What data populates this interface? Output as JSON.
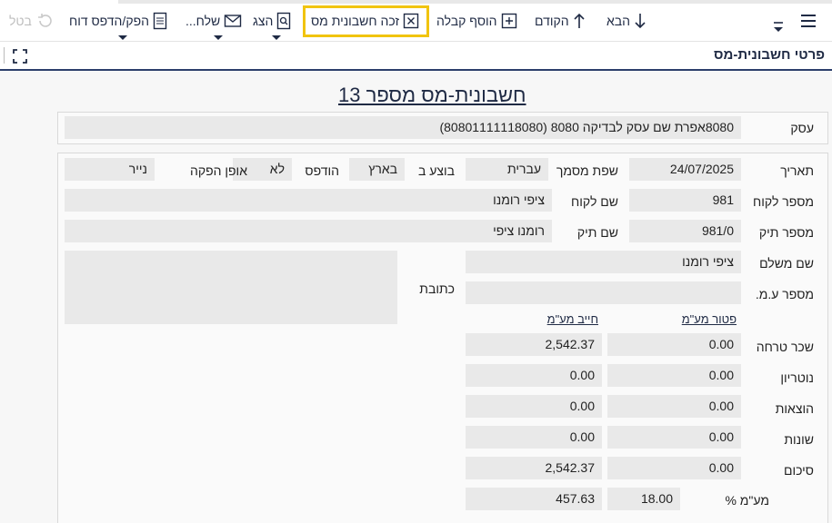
{
  "toolbar": {
    "cancel_label": "בטל",
    "print_label": "הפק/הדפס דוח",
    "send_label": "שלח...",
    "show_label": "הצג",
    "credit_label": "זכה חשבונית מס",
    "add_receipt_label": "הוסף קבלה",
    "previous_label": "הקודם",
    "next_label": "הבא"
  },
  "section": {
    "title": "פרטי חשבונית-מס"
  },
  "document": {
    "title": "חשבונית-מס מספר 13"
  },
  "business": {
    "label": "עסק",
    "value": "8080אפרת שם עסק לבדיקה 8080 (80801111118080)"
  },
  "fields": {
    "date_label": "תאריך",
    "date_value": "24/07/2025",
    "doc_lang_label": "שפת מסמך",
    "doc_lang_value": "עברית",
    "performed_in_label": "בוצע ב",
    "performed_in_value": "בארץ",
    "printed_label": "הודפס",
    "printed_value": "לא",
    "issue_method_label": "אופן הפקה",
    "issue_method_value": "נייר",
    "customer_no_label": "מספר לקוח",
    "customer_no_value": "981",
    "customer_name_label": "שם לקוח",
    "customer_name_value": "ציפי רומנו",
    "file_no_label": "מספר תיק",
    "file_no_value": "981/0",
    "file_name_label": "שם תיק",
    "file_name_value": "רומנו ציפי",
    "payer_name_label": "שם משלם",
    "payer_name_value": "ציפי רומנו",
    "vat_no_label": "מספר ע.מ.",
    "vat_no_value": "",
    "address_label": "כתובת",
    "address_value": ""
  },
  "amounts": {
    "exempt_header": "פטור מע\"מ",
    "taxable_header": "חייב מע\"מ",
    "rows": [
      {
        "label": "שכר טרחה",
        "exempt": "0.00",
        "taxable": "2,542.37"
      },
      {
        "label": "נוטריון",
        "exempt": "0.00",
        "taxable": "0.00"
      },
      {
        "label": "הוצאות",
        "exempt": "0.00",
        "taxable": "0.00"
      },
      {
        "label": "שונות",
        "exempt": "0.00",
        "taxable": "0.00"
      },
      {
        "label": "סיכום",
        "exempt": "0.00",
        "taxable": "2,542.37"
      }
    ],
    "vat_label": "מע\"מ %",
    "vat_rate": "18.00",
    "vat_amount": "457.63"
  }
}
